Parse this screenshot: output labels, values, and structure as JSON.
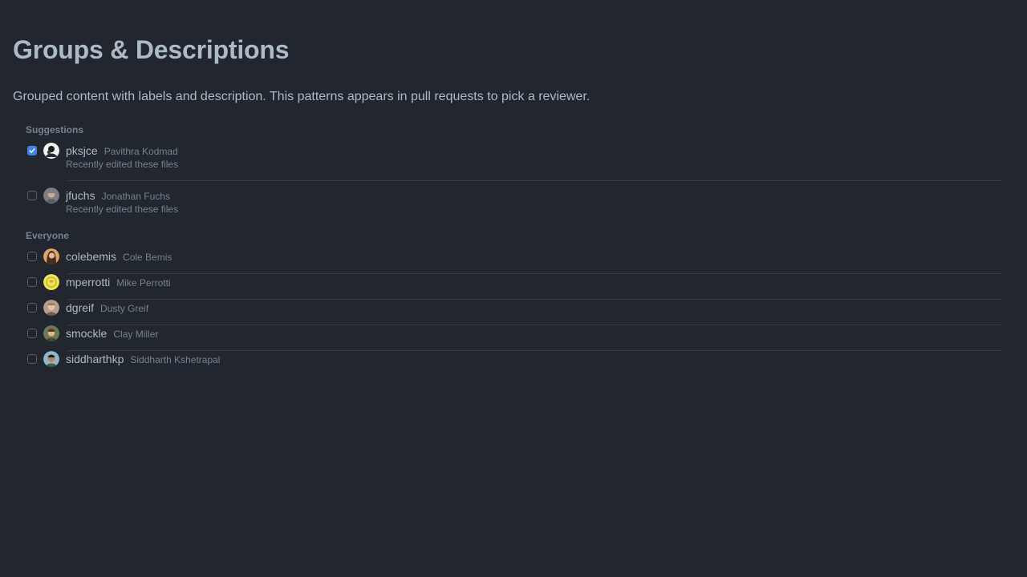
{
  "page": {
    "title": "Groups & Descriptions",
    "description": "Grouped content with labels and description. This patterns appears in pull requests to pick a reviewer."
  },
  "groups": [
    {
      "header": "Suggestions",
      "items": [
        {
          "username": "pksjce",
          "fullname": "Pavithra Kodmad",
          "description": "Recently edited these files",
          "checked": true,
          "avatar": "avatar-pksjce"
        },
        {
          "username": "jfuchs",
          "fullname": "Jonathan Fuchs",
          "description": "Recently edited these files",
          "checked": false,
          "avatar": "avatar-jfuchs"
        }
      ]
    },
    {
      "header": "Everyone",
      "items": [
        {
          "username": "colebemis",
          "fullname": "Cole Bemis",
          "checked": false,
          "avatar": "avatar-colebemis"
        },
        {
          "username": "mperrotti",
          "fullname": "Mike Perrotti",
          "checked": false,
          "avatar": "avatar-mperrotti"
        },
        {
          "username": "dgreif",
          "fullname": "Dusty Greif",
          "checked": false,
          "avatar": "avatar-dgreif"
        },
        {
          "username": "smockle",
          "fullname": "Clay Miller",
          "checked": false,
          "avatar": "avatar-smockle"
        },
        {
          "username": "siddharthkp",
          "fullname": "Siddharth Kshetrapal",
          "checked": false,
          "avatar": "avatar-siddharthkp"
        }
      ]
    }
  ],
  "colors": {
    "background": "#22262e",
    "accent": "#4184e4",
    "text_primary": "#adbac7",
    "text_muted": "#768390",
    "divider": "#373e47"
  }
}
